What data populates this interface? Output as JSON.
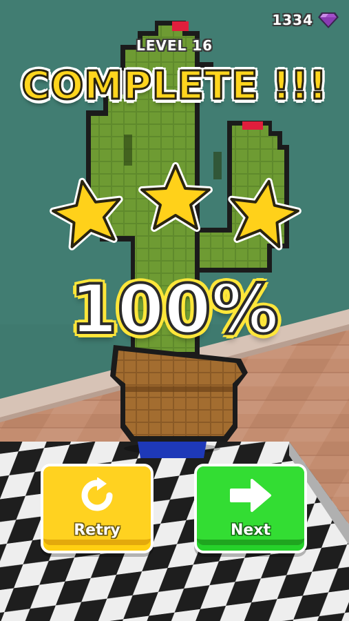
{
  "hud": {
    "gems": "1334",
    "gem_icon": "purple-gem"
  },
  "level": {
    "label": "LEVEL 16"
  },
  "result": {
    "title": "COMPLETE !!!",
    "percent": "100%",
    "stars_earned": 3,
    "stars_total": 3
  },
  "buttons": {
    "retry": {
      "label": "Retry",
      "icon": "refresh-icon"
    },
    "next": {
      "label": "Next",
      "icon": "arrow-right-icon"
    }
  },
  "colors": {
    "accent_yellow": "#ffd51e",
    "star": "#ffd11a",
    "retry_bg": "#ffd220",
    "next_bg": "#33dd33",
    "gem": "#a24fc9"
  }
}
